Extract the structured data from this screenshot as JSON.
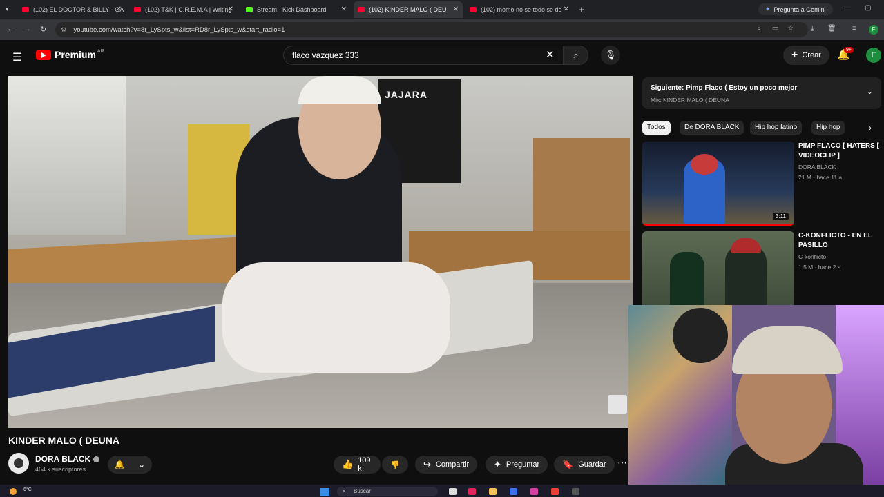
{
  "browser": {
    "tabs": [
      {
        "label": "(102) EL DOCTOR & BILLY - GA"
      },
      {
        "label": "(102) T&K | C.R.E.M.A | Writing"
      },
      {
        "label": "Stream - Kick Dashboard"
      },
      {
        "label": "(102) KINDER MALO ( DEU"
      },
      {
        "label": "(102) momo no se todo se de"
      }
    ],
    "gemini_label": "Pregunta a Gemini",
    "url": "youtube.com/watch?v=8r_LySpts_w&list=RD8r_LySpts_w&start_radio=1",
    "profile_initial": "F"
  },
  "youtube": {
    "logo_text": "Premium",
    "country_code": "AR",
    "search_value": "flaco vazquez 333",
    "create_label": "Crear",
    "notif_count": "9+",
    "avatar_initial": "F"
  },
  "video": {
    "bag_text": "JAJARA",
    "title": "KINDER MALO ( DEUNA",
    "channel": "DORA BLACK",
    "subscribers": "464 k suscriptores",
    "likes": "109 k",
    "share_label": "Compartir",
    "ask_label": "Preguntar",
    "save_label": "Guardar"
  },
  "sidebar": {
    "next_label": "Siguiente: Pimp Flaco ( Estoy un poco mejor",
    "next_sub": "Mix: KINDER MALO ( DEUNA",
    "chips": [
      "Todos",
      "De DORA BLACK",
      "Hip hop latino",
      "Hip hop"
    ],
    "videos": [
      {
        "title": "PIMP FLACO [ HATERS [ VIDEOCLIP ]",
        "channel": "DORA BLACK",
        "meta": "21 M · hace 11 a",
        "duration": "3:11"
      },
      {
        "title": "C-KONFLICTO - EN EL PASILLO",
        "channel": "C-konflicto",
        "meta": "1.5 M · hace 2 a"
      }
    ]
  },
  "taskbar": {
    "temperature": "6°C",
    "search_label": "Buscar"
  },
  "colors": {
    "accent": "#ff0000",
    "background": "#0f0f0f"
  }
}
